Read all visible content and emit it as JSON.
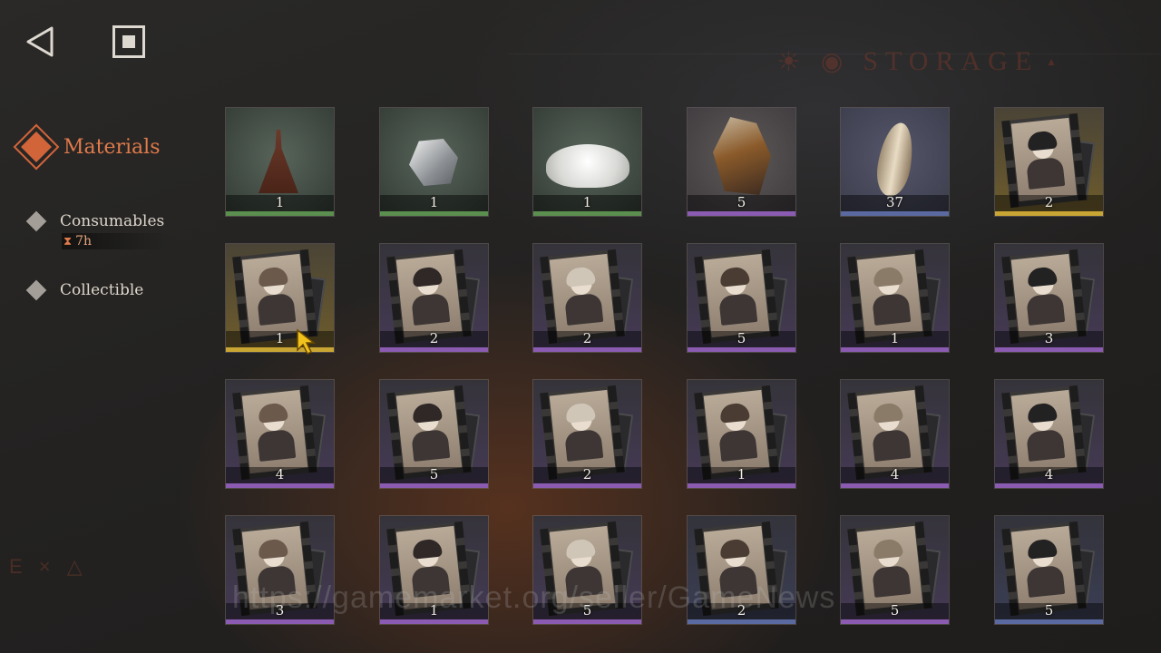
{
  "nav": {
    "back_icon": "back-triangle-icon",
    "home_icon": "square-stop-icon"
  },
  "sidebar": {
    "active": {
      "label": "Materials",
      "icon": "diamond-active-icon"
    },
    "items": [
      {
        "label": "Consumables",
        "timer": "7h",
        "timer_icon": "hourglass-icon"
      },
      {
        "label": "Collectible"
      }
    ]
  },
  "decor": {
    "storage_text": "STORAGE",
    "corner_text": "E × △",
    "watermark": "https://gamemarket.org/seller/GameNews"
  },
  "rarity_colors": {
    "green": "#5b8f4f",
    "purple": "#8a5bb0",
    "blue": "#5a6aa0",
    "gold": "#c9a634"
  },
  "items": [
    {
      "name": "brush",
      "count": "1",
      "rarity": "green"
    },
    {
      "name": "silver-ore",
      "count": "1",
      "rarity": "green"
    },
    {
      "name": "salt-crystals",
      "count": "1",
      "rarity": "green"
    },
    {
      "name": "amber-crystal",
      "count": "5",
      "rarity": "purple"
    },
    {
      "name": "feather-shell",
      "count": "37",
      "rarity": "blue"
    },
    {
      "name": "camera-card",
      "count": "2",
      "rarity": "gold"
    },
    {
      "name": "sheep-card",
      "count": "1",
      "rarity": "gold"
    },
    {
      "name": "horned-girl-card",
      "count": "2",
      "rarity": "purple"
    },
    {
      "name": "curly-girl-card",
      "count": "2",
      "rarity": "purple"
    },
    {
      "name": "ghost-card",
      "count": "5",
      "rarity": "purple"
    },
    {
      "name": "hat-lady-card",
      "count": "1",
      "rarity": "purple"
    },
    {
      "name": "scarecrow-card",
      "count": "3",
      "rarity": "purple"
    },
    {
      "name": "dark-lady-card",
      "count": "4",
      "rarity": "purple"
    },
    {
      "name": "apple-bow-card",
      "count": "5",
      "rarity": "purple"
    },
    {
      "name": "hooded-girl-card",
      "count": "2",
      "rarity": "purple"
    },
    {
      "name": "top-hat-man-card",
      "count": "1",
      "rarity": "purple"
    },
    {
      "name": "glasses-man-card",
      "count": "4",
      "rarity": "purple"
    },
    {
      "name": "bunny-girl-card",
      "count": "4",
      "rarity": "purple"
    },
    {
      "name": "white-hair-card",
      "count": "3",
      "rarity": "purple"
    },
    {
      "name": "clown-girl-card",
      "count": "1",
      "rarity": "purple"
    },
    {
      "name": "rabbit-mask-card",
      "count": "5",
      "rarity": "purple"
    },
    {
      "name": "fedora-man-card",
      "count": "2",
      "rarity": "blue"
    },
    {
      "name": "metal-ball-card",
      "count": "5",
      "rarity": "purple"
    },
    {
      "name": "masked-doll-card",
      "count": "5",
      "rarity": "blue"
    }
  ]
}
